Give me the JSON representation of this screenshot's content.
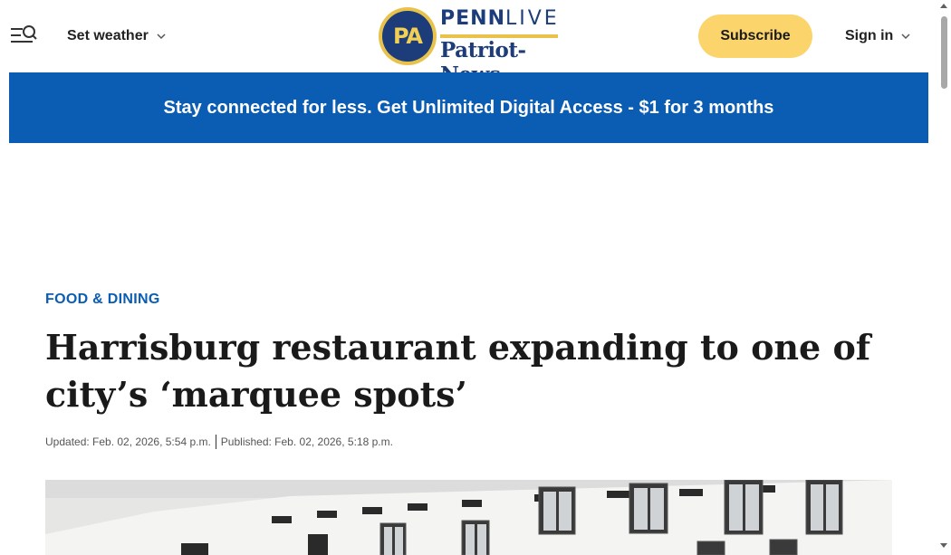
{
  "header": {
    "menu_icon": "menu-search-icon",
    "weather_label": "Set weather",
    "logo": {
      "badge_text": "PA",
      "brand_bold": "PENN",
      "brand_light": "LIVE",
      "sub_brand": "Patriot-News"
    },
    "subscribe_label": "Subscribe",
    "signin_label": "Sign in"
  },
  "banner": {
    "text": "Stay connected for less. Get Unlimited Digital Access - $1 for 3 months"
  },
  "article": {
    "section": "FOOD & DINING",
    "headline": "Harrisburg restaurant expanding to one of city’s ‘marquee spots’",
    "updated": "Updated: Feb. 02, 2026, 5:54 p.m.",
    "published": "Published: Feb. 02, 2026, 5:18 p.m."
  },
  "colors": {
    "accent_blue": "#0b5cb3",
    "subscribe_yellow": "#fbd46b",
    "logo_navy": "#1d3d7a",
    "logo_gold": "#e8c24b"
  }
}
